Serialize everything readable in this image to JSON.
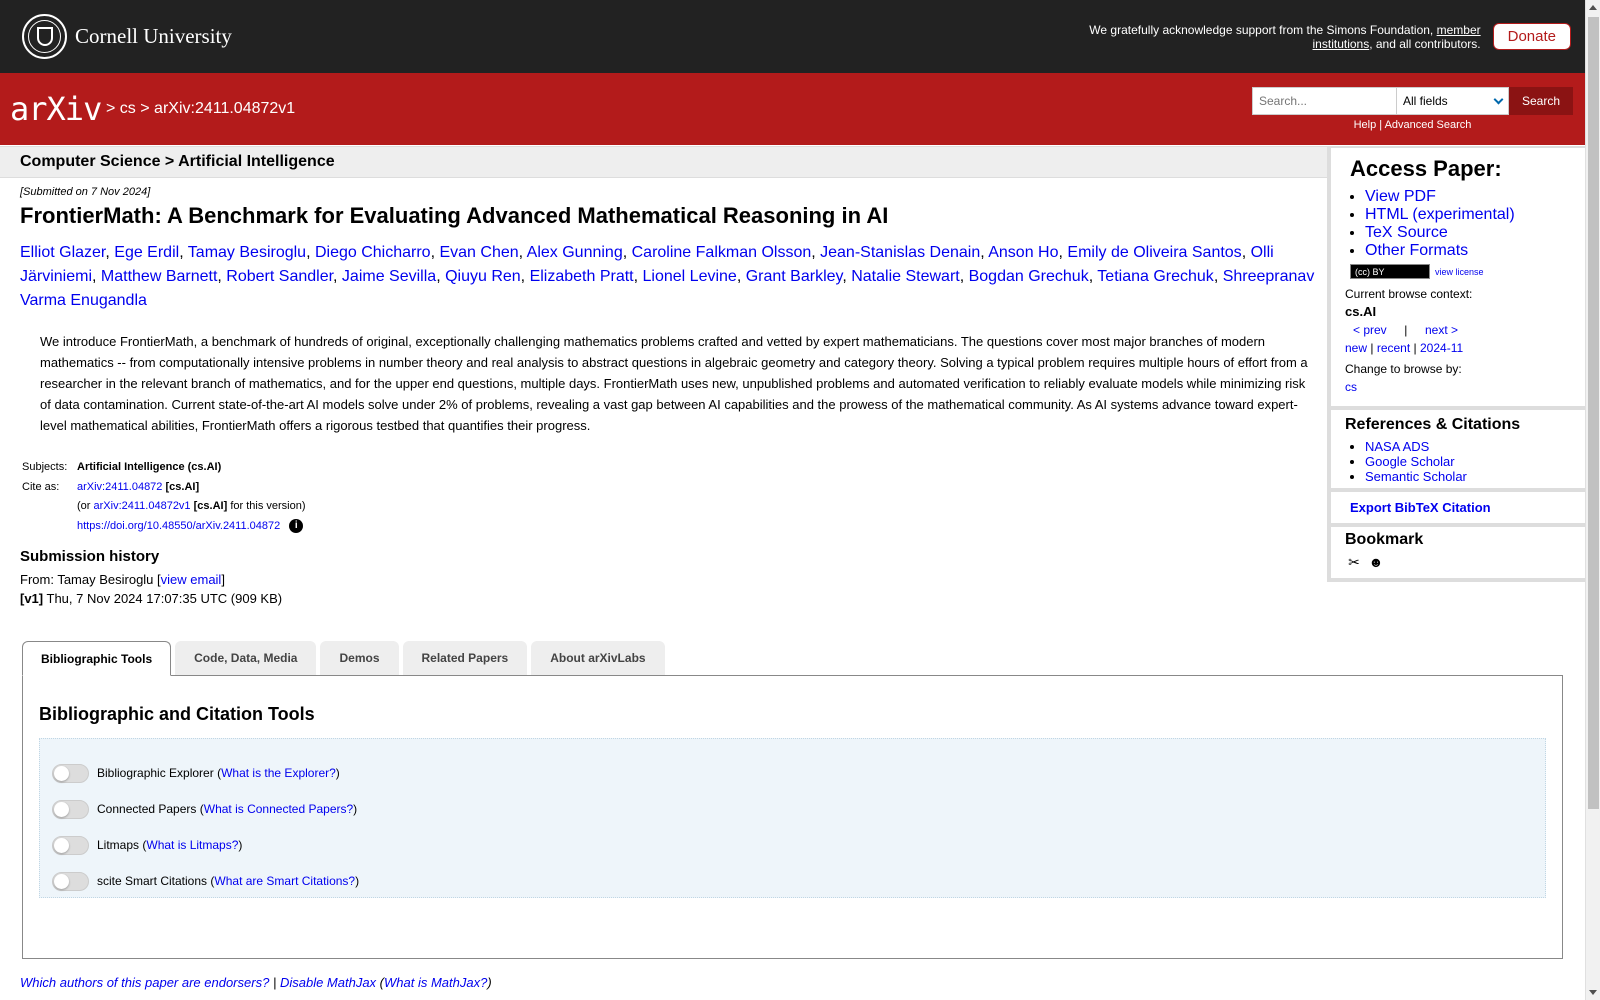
{
  "topbar": {
    "institution": "Cornell University",
    "support_prefix": "We gratefully acknowledge support from the Simons Foundation,",
    "support_link": "member institutions",
    "support_suffix": ", and all contributors.",
    "donate": "Donate"
  },
  "header": {
    "logo_text": "arXiv",
    "crumb_sep1": ">",
    "crumb_cs": "cs",
    "crumb_sep2": ">",
    "crumb_id": "arXiv:2411.04872v1",
    "search_placeholder": "Search...",
    "search_field": "All fields",
    "search_button": "Search",
    "help": "Help",
    "link_sep": "|",
    "advanced": "Advanced Search"
  },
  "subhead": "Computer Science > Artificial Intelligence",
  "paper": {
    "submitted": "[Submitted on 7 Nov 2024]",
    "title": "FrontierMath: A Benchmark for Evaluating Advanced Mathematical Reasoning in AI",
    "authors": [
      "Elliot Glazer",
      "Ege Erdil",
      "Tamay Besiroglu",
      "Diego Chicharro",
      "Evan Chen",
      "Alex Gunning",
      "Caroline Falkman Olsson",
      "Jean-Stanislas Denain",
      "Anson Ho",
      "Emily de Oliveira Santos",
      "Olli Järviniemi",
      "Matthew Barnett",
      "Robert Sandler",
      "Jaime Sevilla",
      "Qiuyu Ren",
      "Elizabeth Pratt",
      "Lionel Levine",
      "Grant Barkley",
      "Natalie Stewart",
      "Bogdan Grechuk",
      "Tetiana Grechuk",
      "Shreepranav Varma Enugandla"
    ],
    "abstract": "We introduce FrontierMath, a benchmark of hundreds of original, exceptionally challenging mathematics problems crafted and vetted by expert mathematicians. The questions cover most major branches of modern mathematics -- from computationally intensive problems in number theory and real analysis to abstract questions in algebraic geometry and category theory. Solving a typical problem requires multiple hours of effort from a researcher in the relevant branch of mathematics, and for the upper end questions, multiple days. FrontierMath uses new, unpublished problems and automated verification to reliably evaluate models while minimizing risk of data contamination. Current state-of-the-art AI models solve under 2% of problems, revealing a vast gap between AI capabilities and the prowess of the mathematical community. As AI systems advance toward expert-level mathematical abilities, FrontierMath offers a rigorous testbed that quantifies their progress.",
    "subjects_label": "Subjects:",
    "subjects": "Artificial Intelligence (cs.AI)",
    "cite_label": "Cite as:",
    "cite_id": "arXiv:2411.04872",
    "cite_cat": "[cs.AI]",
    "cite_or": "(or",
    "cite_v_id": "arXiv:2411.04872v1",
    "cite_v_cat": "[cs.AI]",
    "cite_v_suffix": "for this version)",
    "doi": "https://doi.org/10.48550/arXiv.2411.04872",
    "info_icon": "i"
  },
  "history": {
    "title": "Submission history",
    "from_prefix": "From: Tamay Besiroglu [",
    "view_email": "view email",
    "from_suffix": "]",
    "v1_label": "[v1]",
    "v1_text": "Thu, 7 Nov 2024 17:07:35 UTC (909 KB)"
  },
  "sidebar": {
    "access_title": "Access Paper:",
    "access_links": [
      "View PDF",
      "HTML (experimental)",
      "TeX Source",
      "Other Formats"
    ],
    "cc_badge": "(cc) BY",
    "view_license": "view license",
    "context_label": "Current browse context:",
    "context": "cs.AI",
    "prev": "< prev",
    "nav_sep": "|",
    "next": "next >",
    "new": "new",
    "recent": "recent",
    "month": "2024-11",
    "change_label": "Change to browse by:",
    "change_cs": "cs",
    "refs_title": "References & Citations",
    "refs": [
      "NASA ADS",
      "Google Scholar",
      "Semantic Scholar"
    ],
    "bibtex": "Export BibTeX Citation",
    "bookmark_title": "Bookmark",
    "bookmark_icons": [
      "bibsonomy-icon",
      "reddit-icon"
    ]
  },
  "tabs": [
    "Bibliographic Tools",
    "Code, Data, Media",
    "Demos",
    "Related Papers",
    "About arXivLabs"
  ],
  "panel": {
    "title": "Bibliographic and Citation Tools",
    "tools": [
      {
        "name": "Bibliographic Explorer",
        "link": "What is the Explorer?"
      },
      {
        "name": "Connected Papers",
        "link": "What is Connected Papers?"
      },
      {
        "name": "Litmaps",
        "link": "What is Litmaps?"
      },
      {
        "name": "scite Smart Citations",
        "link": "What are Smart Citations?"
      }
    ]
  },
  "footer": {
    "endorsers": "Which authors of this paper are endorsers?",
    "sep": "|",
    "mathjax": "Disable MathJax",
    "what_mathjax": "What is MathJax?"
  }
}
